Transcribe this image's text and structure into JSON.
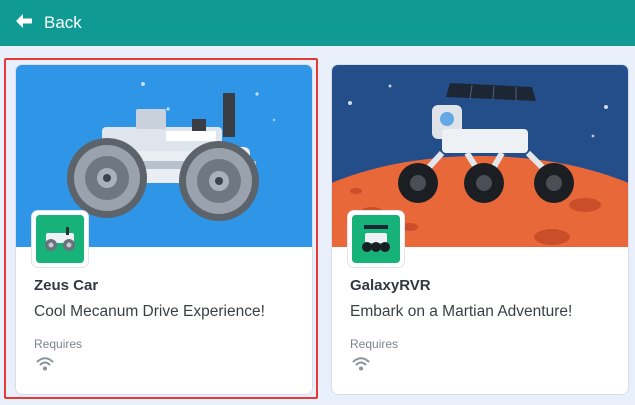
{
  "header": {
    "back_label": "Back",
    "back_icon": "arrow-left-icon",
    "bar_color": "#0f9a93"
  },
  "extensions": [
    {
      "title": "Zeus Car",
      "subtitle": "Cool Mecanum Drive Experience!",
      "requires_label": "Requires",
      "requirement_icon": "wifi-icon",
      "banner_color": "#2f95e6",
      "selected": true
    },
    {
      "title": "GalaxyRVR",
      "subtitle": "Embark on a Martian Adventure!",
      "requires_label": "Requires",
      "requirement_icon": "wifi-icon",
      "banner_color": "#244e8a",
      "selected": false
    }
  ],
  "colors": {
    "selection_outline": "#e53935",
    "thumb_green": "#16b27a",
    "mars": "#e9683a"
  }
}
